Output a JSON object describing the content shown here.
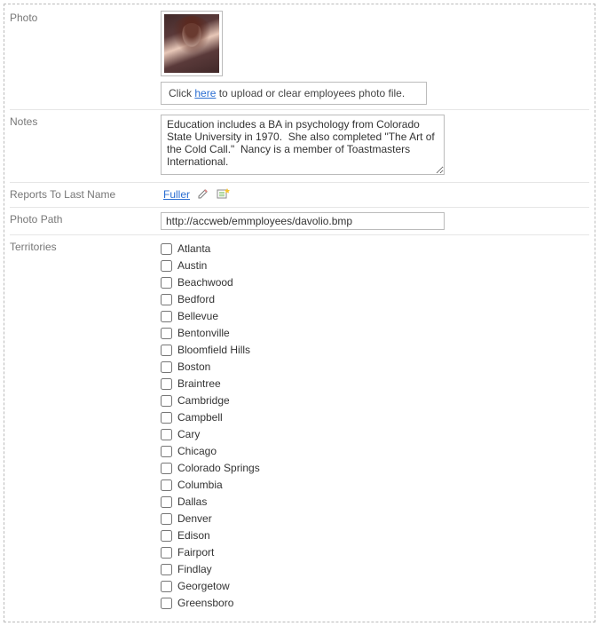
{
  "rows": {
    "photo": {
      "label": "Photo",
      "upload_prefix": "Click ",
      "upload_link": "here",
      "upload_suffix": " to upload or clear employees photo file."
    },
    "notes": {
      "label": "Notes",
      "value": "Education includes a BA in psychology from Colorado State University in 1970.  She also completed \"The Art of the Cold Call.\"  Nancy is a member of Toastmasters International."
    },
    "reports_to": {
      "label": "Reports To Last Name",
      "value": "Fuller"
    },
    "photo_path": {
      "label": "Photo Path",
      "value": "http://accweb/emmployees/davolio.bmp"
    },
    "territories": {
      "label": "Territories",
      "items": [
        "Atlanta",
        "Austin",
        "Beachwood",
        "Bedford",
        "Bellevue",
        "Bentonville",
        "Bloomfield Hills",
        "Boston",
        "Braintree",
        "Cambridge",
        "Campbell",
        "Cary",
        "Chicago",
        "Colorado Springs",
        "Columbia",
        "Dallas",
        "Denver",
        "Edison",
        "Fairport",
        "Findlay",
        "Georgetow",
        "Greensboro"
      ]
    }
  }
}
